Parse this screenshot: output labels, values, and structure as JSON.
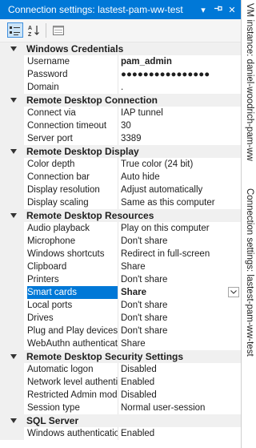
{
  "window": {
    "title": "Connection settings: lastest-pam-ww-test"
  },
  "side_tabs": [
    "VM instance: daniel-woodrich-pam-ww",
    "Connection settings: lastest-pam-ww-test"
  ],
  "categories": [
    {
      "title": "Windows Credentials",
      "props": [
        {
          "name": "Username",
          "value": "pam_admin",
          "bold": true
        },
        {
          "name": "Password",
          "value": "●●●●●●●●●●●●●●●●",
          "bold": true
        },
        {
          "name": "Domain",
          "value": "."
        }
      ]
    },
    {
      "title": "Remote Desktop Connection",
      "props": [
        {
          "name": "Connect via",
          "value": "IAP tunnel"
        },
        {
          "name": "Connection timeout",
          "value": "30"
        },
        {
          "name": "Server port",
          "value": "3389"
        }
      ]
    },
    {
      "title": "Remote Desktop Display",
      "props": [
        {
          "name": "Color depth",
          "value": "True color (24 bit)"
        },
        {
          "name": "Connection bar",
          "value": "Auto hide"
        },
        {
          "name": "Display resolution",
          "value": "Adjust automatically"
        },
        {
          "name": "Display scaling",
          "value": "Same as this computer"
        }
      ]
    },
    {
      "title": "Remote Desktop Resources",
      "props": [
        {
          "name": "Audio playback",
          "value": "Play on this computer"
        },
        {
          "name": "Microphone",
          "value": "Don't share"
        },
        {
          "name": "Windows shortcuts",
          "value": "Redirect in full-screen"
        },
        {
          "name": "Clipboard",
          "value": "Share"
        },
        {
          "name": "Printers",
          "value": "Don't share"
        },
        {
          "name": "Smart cards",
          "value": "Share",
          "selected": true
        },
        {
          "name": "Local ports",
          "value": "Don't share"
        },
        {
          "name": "Drives",
          "value": "Don't share"
        },
        {
          "name": "Plug and Play devices",
          "value": "Don't share"
        },
        {
          "name": "WebAuthn authenticators",
          "value": "Share"
        }
      ]
    },
    {
      "title": "Remote Desktop Security Settings",
      "props": [
        {
          "name": "Automatic logon",
          "value": "Disabled"
        },
        {
          "name": "Network level authentication",
          "value": "Enabled"
        },
        {
          "name": "Restricted Admin mode",
          "value": "Disabled"
        },
        {
          "name": "Session type",
          "value": "Normal user-session"
        }
      ]
    },
    {
      "title": "SQL Server",
      "props": [
        {
          "name": "Windows authentication",
          "value": "Enabled"
        }
      ]
    }
  ]
}
